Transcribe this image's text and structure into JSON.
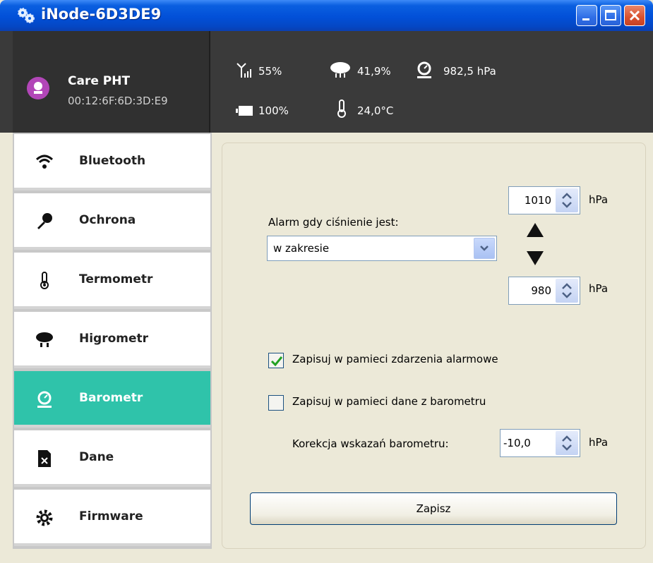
{
  "window": {
    "title": "iNode-6D3DE9"
  },
  "device": {
    "name": "Care PHT",
    "mac": "00:12:6F:6D:3D:E9"
  },
  "status": {
    "signal": "55%",
    "humidity": "41,9%",
    "pressure": "982,5 hPa",
    "battery": "100%",
    "temperature": "24,0°C"
  },
  "nav": [
    {
      "label": "Bluetooth",
      "icon": "wifi-icon"
    },
    {
      "label": "Ochrona",
      "icon": "key-icon"
    },
    {
      "label": "Termometr",
      "icon": "thermometer-icon"
    },
    {
      "label": "Higrometr",
      "icon": "rain-cloud-icon"
    },
    {
      "label": "Barometr",
      "icon": "barometer-icon",
      "active": true
    },
    {
      "label": "Dane",
      "icon": "file-delete-icon"
    },
    {
      "label": "Firmware",
      "icon": "gear-icon"
    }
  ],
  "alarm": {
    "label": "Alarm gdy ciśnienie jest:",
    "mode": "w zakresie",
    "upper": "1010",
    "lower": "980",
    "unit": "hPa"
  },
  "options": {
    "log_alarms": {
      "label": "Zapisuj w pamieci zdarzenia alarmowe",
      "checked": true
    },
    "log_data": {
      "label": "Zapisuj w pamieci dane z barometru",
      "checked": false
    }
  },
  "correction": {
    "label": "Korekcja wskazań barometru:",
    "value": "-10,0",
    "unit": "hPa"
  },
  "save_label": "Zapisz",
  "colors": {
    "accent": "#2fc3aa",
    "header": "#3a3a3a",
    "titlebar": "#0250d8"
  }
}
